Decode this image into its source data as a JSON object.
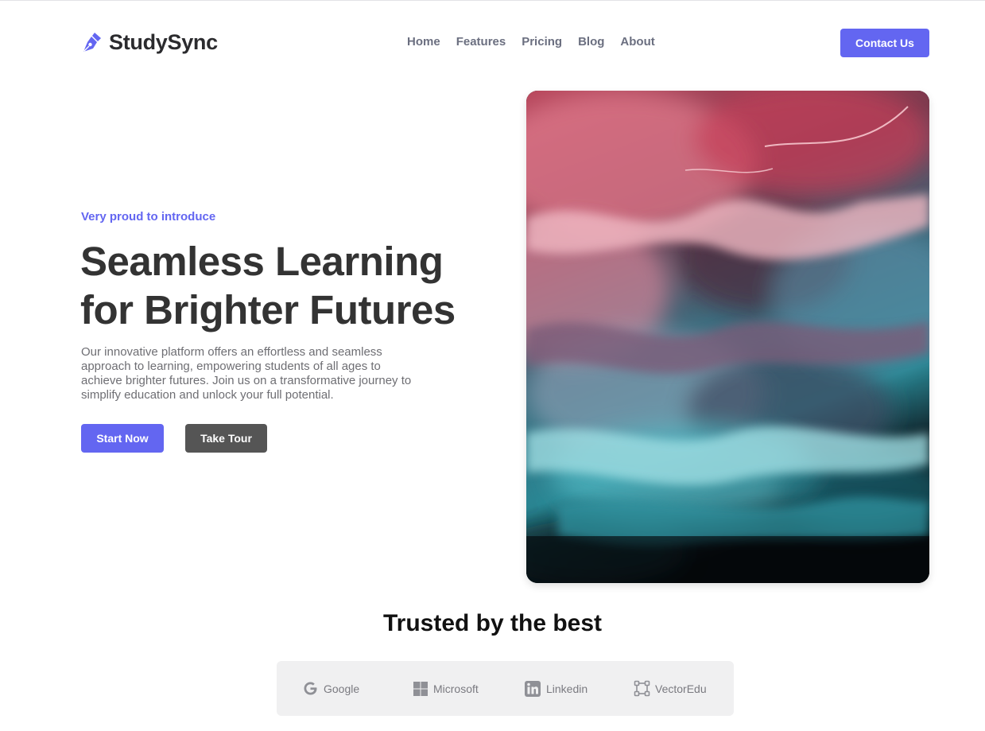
{
  "brand": {
    "name": "StudySync",
    "icon": "pen-nib-icon"
  },
  "nav": {
    "items": [
      {
        "label": "Home"
      },
      {
        "label": "Features"
      },
      {
        "label": "Pricing"
      },
      {
        "label": "Blog"
      },
      {
        "label": "About"
      }
    ],
    "contact_label": "Contact Us"
  },
  "hero": {
    "eyebrow": "Very proud to introduce",
    "headline_line1": "Seamless Learning",
    "headline_line2": "for Brighter Futures",
    "description": "Our innovative platform offers an effortless and seamless approach to learning, empowering students of all ages to achieve brighter futures. Join us on a transformative journey to simplify education and unlock your full potential.",
    "primary_cta": "Start Now",
    "secondary_cta": "Take Tour"
  },
  "trusted": {
    "title": "Trusted by the best",
    "logos": [
      {
        "name": "Google",
        "icon": "google-icon"
      },
      {
        "name": "Microsoft",
        "icon": "windows-icon"
      },
      {
        "name": "Linkedin",
        "icon": "linkedin-icon"
      },
      {
        "name": "VectorEdu",
        "icon": "vector-square-icon"
      }
    ]
  },
  "colors": {
    "accent": "#6366f1",
    "dark_button": "#555555",
    "text_primary": "#333333",
    "text_muted": "#6e6e73",
    "logos_bar_bg": "#f0f0f1"
  }
}
